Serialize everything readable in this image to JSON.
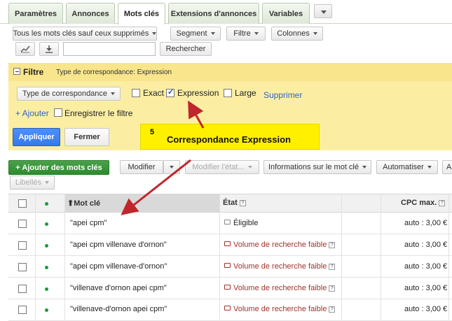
{
  "tabs": [
    {
      "label": "Paramètres",
      "active": false
    },
    {
      "label": "Annonces",
      "active": false
    },
    {
      "label": "Mots clés",
      "active": true
    },
    {
      "label": "Extensions d'annonces",
      "active": false
    },
    {
      "label": "Variables",
      "active": false
    }
  ],
  "toolbar": {
    "scope_dropdown": "Tous les mots clés sauf ceux supprimés",
    "segment": "Segment",
    "filter": "Filtre",
    "columns": "Colonnes",
    "search_value": "",
    "search_button": "Rechercher",
    "chart_icon": "line-chart-icon",
    "download_icon": "download-icon"
  },
  "filter": {
    "title": "Filtre",
    "subtitle": "Type de correspondance: Expression",
    "match_type_dropdown": "Type de correspondance",
    "options": [
      {
        "label": "Exact",
        "checked": false
      },
      {
        "label": "Expression",
        "checked": true
      },
      {
        "label": "Large",
        "checked": false
      }
    ],
    "delete_link": "Supprimer",
    "add_link": "+ Ajouter",
    "save_label": "Enregistrer le filtre",
    "apply_button": "Appliquer",
    "close_button": "Fermer"
  },
  "callout": {
    "number": "5",
    "text": "Correspondance Expression",
    "color": "#fff000"
  },
  "actions": {
    "add_keywords": "+ Ajouter des mots clés",
    "modify": "Modifier",
    "modify_status": "Modifier l'état...",
    "keyword_info": "Informations sur le mot clé",
    "automate": "Automatiser",
    "partial_button": "A",
    "labels": "Libellés"
  },
  "table": {
    "columns": {
      "keyword": "Mot clé",
      "status": "État",
      "max_cpc": "CPC max.",
      "help": "?"
    },
    "rows": [
      {
        "keyword": "\"apei cpm\"",
        "status": "Éligible",
        "status_type": "ok",
        "cpc": "auto : 3,00 €"
      },
      {
        "keyword": "\"apei cpm villenave d'ornon\"",
        "status": "Volume de recherche faible",
        "status_type": "low",
        "cpc": "auto : 3,00 €"
      },
      {
        "keyword": "\"apei cpm villenave-d'ornon\"",
        "status": "Volume de recherche faible",
        "status_type": "low",
        "cpc": "auto : 3,00 €"
      },
      {
        "keyword": "\"villenave d'ornon apei cpm\"",
        "status": "Volume de recherche faible",
        "status_type": "low",
        "cpc": "auto : 3,00 €"
      },
      {
        "keyword": "\"villenave-d'ornon apei cpm\"",
        "status": "Volume de recherche faible",
        "status_type": "low",
        "cpc": "auto : 3,00 €"
      }
    ]
  },
  "colors": {
    "filter_bg": "#fbeea3",
    "apply_blue": "#4d90fe",
    "add_green": "#3a9a3a",
    "enabled_dot": "#1f9a3a",
    "low_volume": "#a2322a",
    "arrow": "#c0262c"
  }
}
